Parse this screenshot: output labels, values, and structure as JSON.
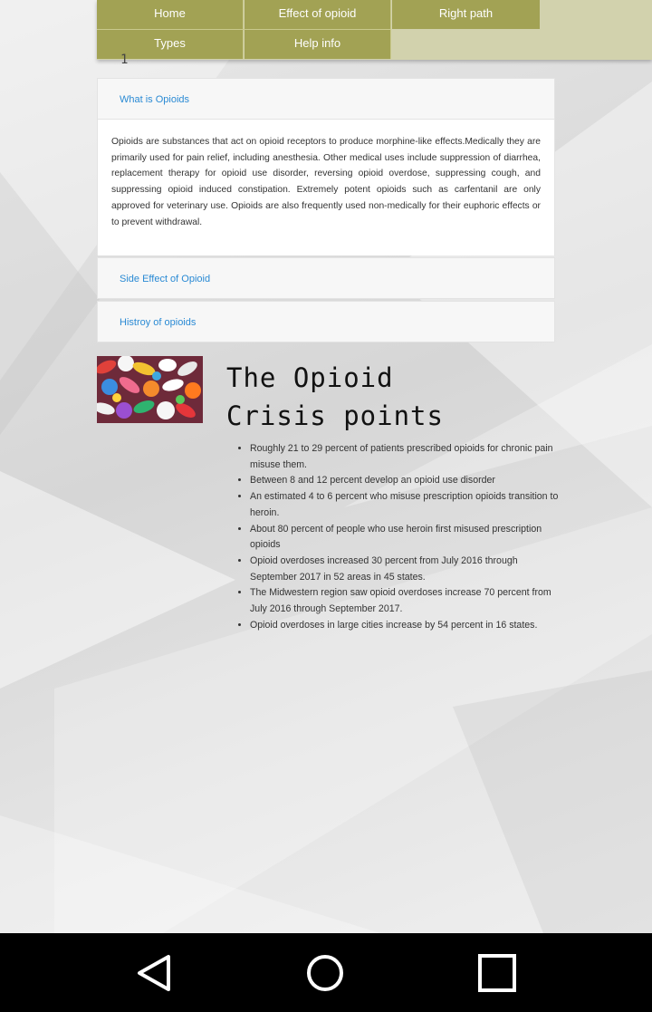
{
  "nav": {
    "items": [
      {
        "label": "Home"
      },
      {
        "label": "Effect of opioid"
      },
      {
        "label": "Right path"
      },
      {
        "label": "Types"
      },
      {
        "label": "Help info"
      }
    ]
  },
  "stray_glyph": "1",
  "accordion": {
    "sections": [
      {
        "title": "What is Opioids",
        "body": "Opioids are substances that act on opioid receptors to produce morphine-like effects.Medically they are primarily used for pain relief, including anesthesia. Other medical uses include suppression of diarrhea, replacement therapy for opioid use disorder, reversing opioid overdose, suppressing cough, and suppressing opioid induced constipation. Extremely potent opioids such as carfentanil are only approved for veterinary use. Opioids are also frequently used non-medically for their euphoric effects or to prevent withdrawal."
      },
      {
        "title": "Side Effect of Opioid"
      },
      {
        "title": "Histroy of opioids"
      }
    ]
  },
  "crisis": {
    "title_line1": "The Opioid",
    "title_line2": "Crisis points",
    "points": [
      "Roughly 21 to 29 percent of patients prescribed opioids for chronic pain misuse them.",
      "Between 8 and 12 percent develop an opioid use disorder",
      "An estimated 4 to 6 percent who misuse prescription opioids transition to heroin.",
      "About 80 percent of people who use heroin first misused prescription opioids",
      "Opioid overdoses increased 30 percent from July 2016 through September 2017 in 52 areas in 45 states.",
      "The Midwestern region saw opioid overdoses increase 70 percent from July 2016 through September 2017.",
      "Opioid overdoses in large cities increase by 54 percent in 16 states."
    ]
  },
  "system_nav": {
    "back": "back-icon",
    "home": "home-icon",
    "recents": "recents-icon"
  },
  "colors": {
    "nav_item": "#a2a254",
    "nav_bar": "#d2d2ad",
    "link": "#2a8ad4"
  }
}
